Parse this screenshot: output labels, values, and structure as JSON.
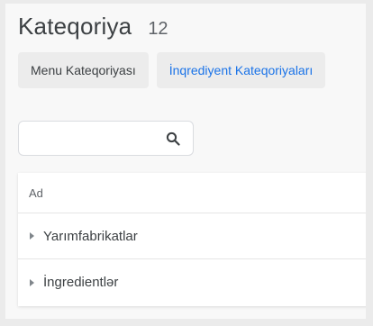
{
  "header": {
    "title": "Kateqoriya",
    "count": "12"
  },
  "tabs": [
    {
      "label": "Menu Kateqoriyası",
      "active": false
    },
    {
      "label": "İnqrediyent Kateqoriyaları",
      "active": true
    }
  ],
  "search": {
    "value": "",
    "placeholder": "",
    "icon": "search-icon"
  },
  "table": {
    "columns": [
      "Ad"
    ],
    "rows": [
      {
        "label": "Yarımfabrikatlar",
        "icon": "chevron-right-icon"
      },
      {
        "label": "İngredientlər",
        "icon": "chevron-right-icon"
      }
    ]
  },
  "colors": {
    "accent": "#1a73e8",
    "text": "#3c4043",
    "muted": "#5f6368",
    "tab_bg": "#ececec",
    "page_bg": "#f8f8f8"
  }
}
